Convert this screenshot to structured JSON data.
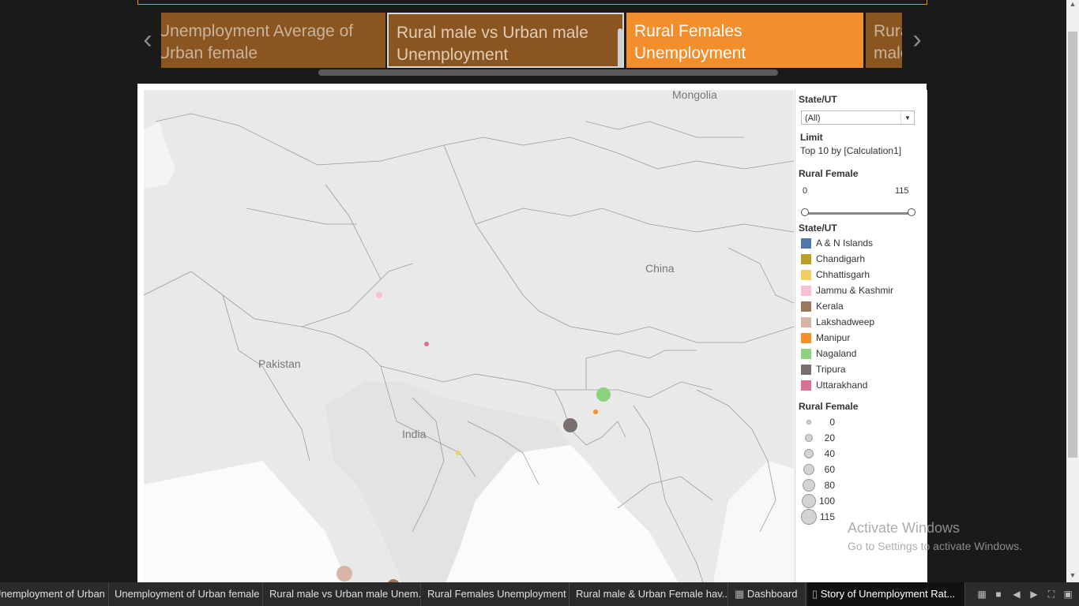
{
  "story_points": [
    {
      "label": "Unemployment Average of Urban female"
    },
    {
      "label": "Rural male vs Urban male Unemployment"
    },
    {
      "label": "Rural Females Unemployment"
    },
    {
      "label": "Rural male & Urban Female have"
    }
  ],
  "map_labels": {
    "mongolia": "Mongolia",
    "china": "China",
    "pakistan": "Pakistan",
    "india": "India"
  },
  "filter": {
    "title": "State/UT",
    "value": "(All)"
  },
  "limit": {
    "title": "Limit",
    "value": "Top 10 by [Calculation1]"
  },
  "range_filter": {
    "title": "Rural Female",
    "min": "0",
    "max": "115"
  },
  "color_legend": {
    "title": "State/UT",
    "items": [
      {
        "label": "A & N Islands",
        "color": "#4e79a7"
      },
      {
        "label": "Chandigarh",
        "color": "#b9a02b"
      },
      {
        "label": "Chhattisgarh",
        "color": "#f1ce63"
      },
      {
        "label": "Jammu & Kashmir",
        "color": "#fabfd2"
      },
      {
        "label": "Kerala",
        "color": "#9d7660"
      },
      {
        "label": "Lakshadweep",
        "color": "#d7b5a6"
      },
      {
        "label": "Manipur",
        "color": "#f28e2b"
      },
      {
        "label": "Nagaland",
        "color": "#8cd17d"
      },
      {
        "label": "Tripura",
        "color": "#79706e"
      },
      {
        "label": "Uttarakhand",
        "color": "#d37295"
      }
    ]
  },
  "size_legend": {
    "title": "Rural Female",
    "items": [
      "0",
      "20",
      "40",
      "60",
      "80",
      "100",
      "115"
    ]
  },
  "watermark": {
    "line1": "Activate Windows",
    "line2": "Go to Settings to activate Windows."
  },
  "tabs": [
    {
      "label": "Unemployment of Urban male"
    },
    {
      "label": "Unemployment of Urban female"
    },
    {
      "label": "Rural male vs Urban male Unem..."
    },
    {
      "label": "Rural Females Unemployment"
    },
    {
      "label": "Rural male & Urban Female hav..."
    },
    {
      "label": "Dashboard"
    },
    {
      "label": "Story of Unemployment Rat..."
    }
  ]
}
